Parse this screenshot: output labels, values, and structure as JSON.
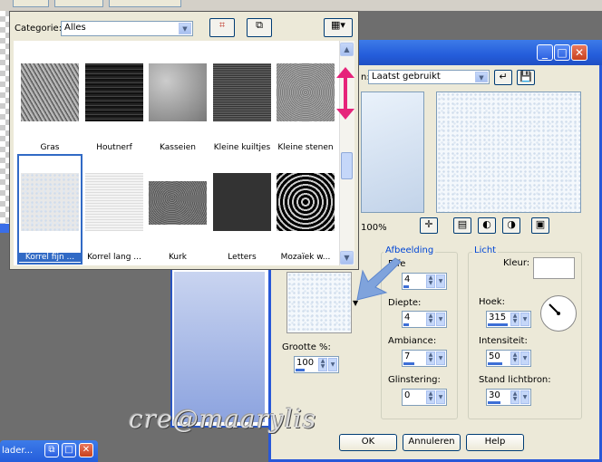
{
  "popup": {
    "category_label": "Categorie:",
    "category_value": "Alles",
    "textures": [
      {
        "label": "Gras",
        "selected": false
      },
      {
        "label": "Houtnerf",
        "selected": false
      },
      {
        "label": "Kasseien",
        "selected": false
      },
      {
        "label": "Kleine kuiltjes",
        "selected": false
      },
      {
        "label": "Kleine stenen",
        "selected": false
      },
      {
        "label": "Korrel fijn ...",
        "selected": true
      },
      {
        "label": "Korrel lang ...",
        "selected": false
      },
      {
        "label": "Kurk",
        "selected": false
      },
      {
        "label": "Letters",
        "selected": false
      },
      {
        "label": "Mozaïek w...",
        "selected": false
      }
    ]
  },
  "dialog": {
    "preset_label": "n:",
    "preset_value": "Laatst gebruikt",
    "zoom": "100%",
    "texture_size_label": "Grootte %:",
    "texture_size_value": "100",
    "afbeelding": {
      "legend": "Afbeelding",
      "effect_label": "Effe",
      "effect_value": "4",
      "diepte_label": "Diepte:",
      "diepte_value": "4",
      "ambiance_label": "Ambiance:",
      "ambiance_value": "7",
      "glinstering_label": "Glinstering:",
      "glinstering_value": "0"
    },
    "licht": {
      "legend": "Licht",
      "kleur_label": "Kleur:",
      "hoek_label": "Hoek:",
      "hoek_value": "315",
      "intensiteit_label": "Intensiteit:",
      "intensiteit_value": "50",
      "stand_label": "Stand lichtbron:",
      "stand_value": "30"
    },
    "buttons": {
      "ok": "OK",
      "cancel": "Annuleren",
      "help": "Help"
    }
  },
  "taskbar": {
    "label": "lader..."
  },
  "watermark": "cre@maarylis",
  "colors": {
    "title_blue": "#245ddb",
    "selected_blue": "#316ac5",
    "arrow_pink": "#e6237a",
    "pointer_blue": "#7fa3dc"
  }
}
